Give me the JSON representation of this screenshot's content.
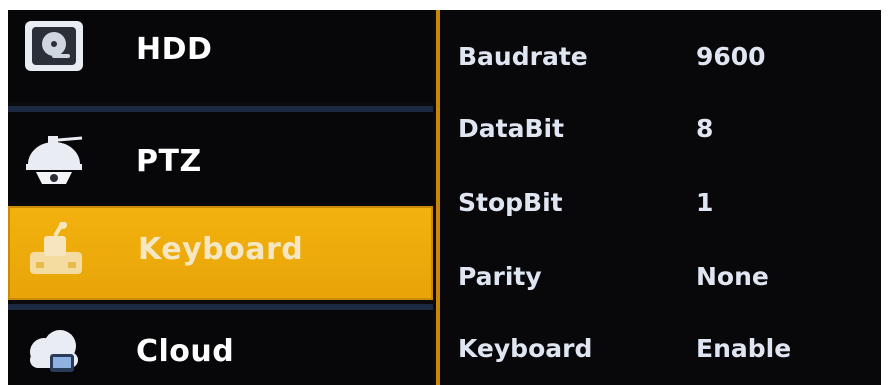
{
  "menu": {
    "items": [
      {
        "label": "HDD",
        "icon": "hdd-icon",
        "selected": false
      },
      {
        "label": "PTZ",
        "icon": "ptz-camera-icon",
        "selected": false
      },
      {
        "label": "Keyboard",
        "icon": "keyboard-joystick-icon",
        "selected": true
      },
      {
        "label": "Cloud",
        "icon": "cloud-icon",
        "selected": false
      }
    ]
  },
  "settings": {
    "rows": [
      {
        "key": "Baudrate",
        "value": "9600"
      },
      {
        "key": "DataBit",
        "value": "8"
      },
      {
        "key": "StopBit",
        "value": "1"
      },
      {
        "key": "Parity",
        "value": "None"
      },
      {
        "key": "Keyboard",
        "value": "Enable"
      }
    ]
  },
  "colors": {
    "accent": "#f3b20f",
    "background": "#0b0b0d",
    "text": "#ffffff"
  }
}
